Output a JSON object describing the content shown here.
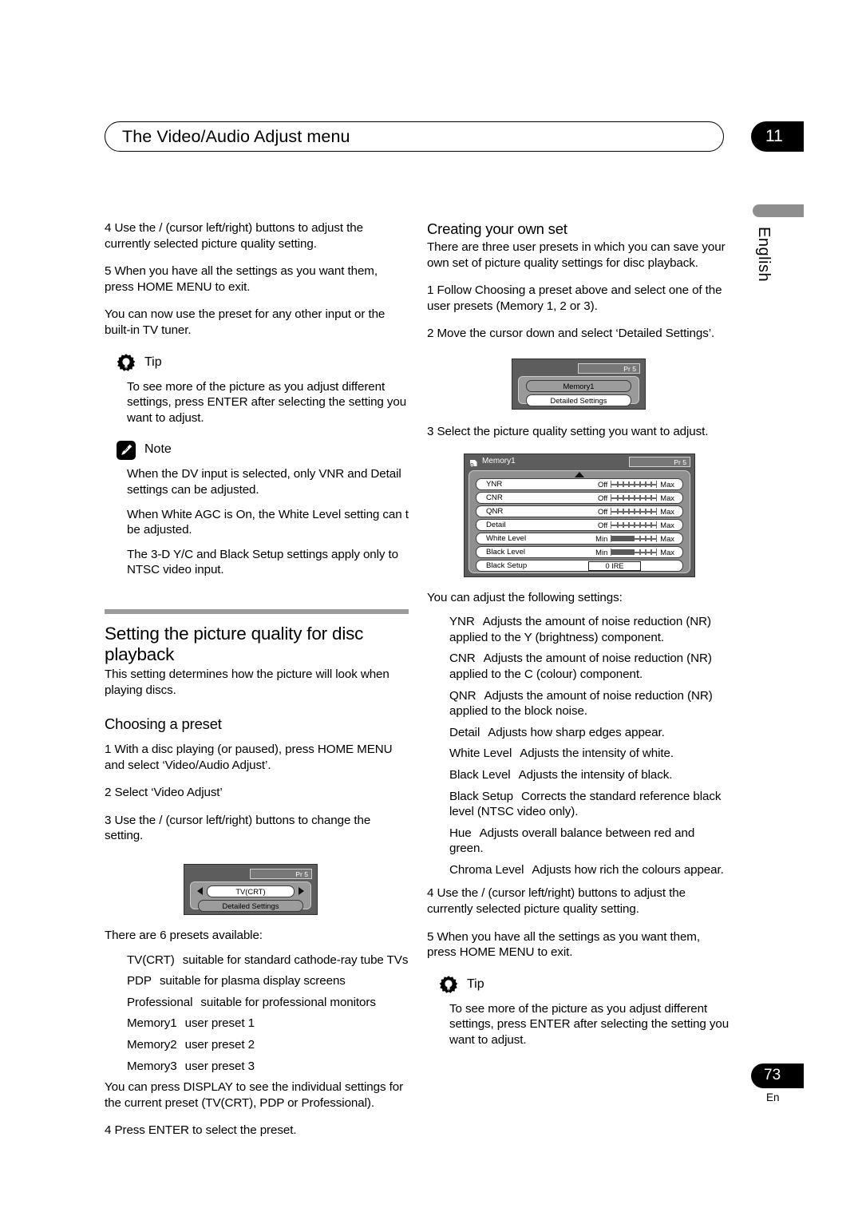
{
  "header": {
    "title": "The Video/Audio Adjust menu",
    "chapter": "11"
  },
  "side": {
    "language": "English"
  },
  "footer": {
    "page_number": "73",
    "language_code": "En"
  },
  "left_column": {
    "step4": "4   Use the  /       (cursor left/right) buttons to adjust the currently selected picture quality setting.",
    "step5": "5   When you have all the settings as you want them, press HOME MENU to exit.",
    "step5_extra": "You can now use the preset for any other input or the built-in TV tuner.",
    "tip": {
      "label": "Tip",
      "icon": "lightbulb-gear-icon",
      "body": "To see more of the picture as you adjust different settings, press ENTER after selecting the setting you want to adjust."
    },
    "note": {
      "label": "Note",
      "icon": "pencil-note-icon",
      "items": [
        "When the DV input is selected, only VNR and Detail settings can be adjusted.",
        "When White AGC is On, the White Level setting can t be adjusted.",
        "The 3-D Y/C and Black Setup settings apply only to NTSC video input."
      ]
    },
    "section": {
      "heading": "Setting the picture quality for disc playback",
      "intro": "This setting determines how the picture will look when playing discs.",
      "subheading": "Choosing a preset",
      "step1": "1   With a disc playing (or paused), press HOME MENU and select ‘Video/Audio Adjust’.",
      "step2": "2   Select ‘Video Adjust’",
      "step3": "3   Use the  /       (cursor left/right) buttons to change the setting.",
      "presets_intro": "There are 6 presets available:",
      "presets": [
        {
          "name": "TV(CRT)",
          "desc": "suitable for standard cathode-ray tube TVs"
        },
        {
          "name": "PDP",
          "desc": "suitable for plasma display screens"
        },
        {
          "name": "Professional",
          "desc": "suitable for professional monitors"
        },
        {
          "name": "Memory1",
          "desc": "user preset 1"
        },
        {
          "name": "Memory2",
          "desc": "user preset 2"
        },
        {
          "name": "Memory3",
          "desc": "user preset 3"
        }
      ],
      "display_note": "You can press DISPLAY to see the individual settings for the current preset (TV(CRT), PDP or Professional).",
      "step4": "4   Press ENTER to select the preset."
    },
    "screenshot_preset": {
      "pr_label": "Pr 5",
      "selected_item": "TV(CRT)",
      "second_item": "Detailed Settings"
    }
  },
  "right_column": {
    "heading": "Creating your own set",
    "intro": "There are three user presets in which you can save your own set of picture quality settings for disc playback.",
    "step1": "1   Follow  Choosing a preset above and select one of the user presets (Memory 1, 2 or 3).",
    "step2": "2   Move the cursor down and select ‘Detailed Settings’.",
    "screenshot_memory": {
      "pr_label": "Pr 5",
      "first_item": "Memory1",
      "second_item": "Detailed Settings"
    },
    "step3": "3   Select the picture quality setting you want to adjust.",
    "screenshot_settings": {
      "title": "Memory1",
      "pr_label": "Pr 5",
      "scroll_up": "▲",
      "scroll_down": "▼",
      "rows": [
        {
          "name": "YNR",
          "left": "Off",
          "right": "Max",
          "type": "gauge",
          "fill": 0
        },
        {
          "name": "CNR",
          "left": "Off",
          "right": "Max",
          "type": "gauge",
          "fill": 0
        },
        {
          "name": "QNR",
          "left": "Off",
          "right": "Max",
          "type": "gauge",
          "fill": 0
        },
        {
          "name": "Detail",
          "left": "Off",
          "right": "Max",
          "type": "gauge",
          "fill": 0
        },
        {
          "name": "White Level",
          "left": "Min",
          "right": "Max",
          "type": "gauge",
          "fill": 52
        },
        {
          "name": "Black Level",
          "left": "Min",
          "right": "Max",
          "type": "gauge",
          "fill": 52
        },
        {
          "name": "Black Setup",
          "left": "",
          "right": "",
          "type": "value",
          "value": "0 IRE"
        }
      ]
    },
    "settings_intro": "You can adjust the following settings:",
    "settings": [
      {
        "name": "YNR",
        "desc": "Adjusts the amount of noise reduction (NR) applied to the Y (brightness) component."
      },
      {
        "name": "CNR",
        "desc": "Adjusts the amount of noise reduction (NR) applied to the C (colour) component."
      },
      {
        "name": "QNR",
        "desc": "Adjusts the amount of noise reduction (NR) applied to the block noise."
      },
      {
        "name": "Detail",
        "desc": "Adjusts how sharp edges appear."
      },
      {
        "name": "White Level",
        "desc": "Adjusts the intensity of white."
      },
      {
        "name": "Black Level",
        "desc": "Adjusts the intensity of black."
      },
      {
        "name": "Black Setup",
        "desc": "Corrects the standard reference black level (NTSC video only)."
      },
      {
        "name": "Hue",
        "desc": "Adjusts overall balance between red and green."
      },
      {
        "name": "Chroma Level",
        "desc": "Adjusts how rich the colours appear."
      }
    ],
    "step4": "4   Use the  /       (cursor left/right) buttons to adjust the currently selected picture quality setting.",
    "step5": "5   When you have all the settings as you want them, press HOME MENU to exit.",
    "tip": {
      "label": "Tip",
      "icon": "lightbulb-gear-icon",
      "body": "To see more of the picture as you adjust different settings, press ENTER after selecting the setting you want to adjust."
    }
  }
}
